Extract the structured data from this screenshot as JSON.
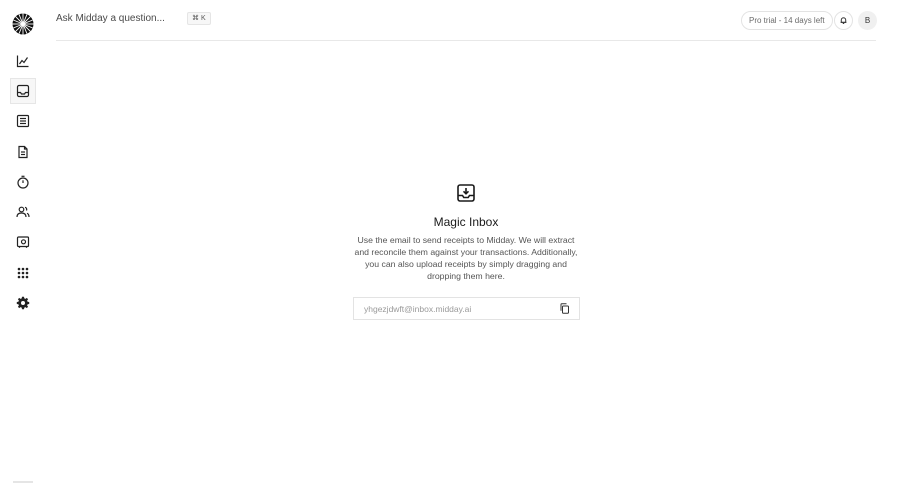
{
  "header": {
    "ask_placeholder": "Ask Midday a question...",
    "shortcut": "⌘ K",
    "trial_badge": "Pro trial - 14 days left",
    "avatar_initial": "B"
  },
  "sidebar": {
    "items": [
      {
        "name": "overview",
        "icon": "chart-line-icon",
        "active": false
      },
      {
        "name": "inbox",
        "icon": "inbox-icon",
        "active": true
      },
      {
        "name": "transactions",
        "icon": "list-icon",
        "active": false
      },
      {
        "name": "invoices",
        "icon": "document-icon",
        "active": false
      },
      {
        "name": "tracker",
        "icon": "stopwatch-icon",
        "active": false
      },
      {
        "name": "customers",
        "icon": "users-icon",
        "active": false
      },
      {
        "name": "vault",
        "icon": "vault-icon",
        "active": false
      },
      {
        "name": "apps",
        "icon": "grid-icon",
        "active": false
      },
      {
        "name": "settings",
        "icon": "gear-icon",
        "active": false
      }
    ]
  },
  "main": {
    "icon": "inbox-download-icon",
    "title": "Magic Inbox",
    "description": "Use the email to send receipts to Midday. We will extract and reconcile them against your transactions. Additionally, you can also upload receipts by simply dragging and dropping them here.",
    "email": "yhgezjdwft@inbox.midday.ai"
  }
}
